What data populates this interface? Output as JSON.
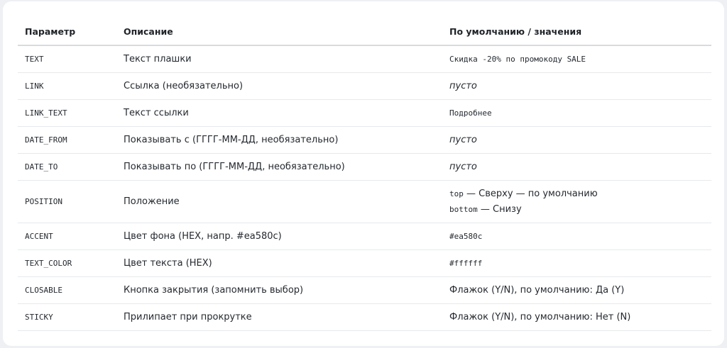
{
  "headers": {
    "param": "Параметр",
    "desc": "Описание",
    "default": "По умолчанию / значения"
  },
  "rows": [
    {
      "param": "TEXT",
      "desc": "Текст плашки",
      "default": "Скидка -20% по промокоду SALE"
    },
    {
      "param": "LINK",
      "desc": "Ссылка (необязательно)",
      "default": "пусто"
    },
    {
      "param": "LINK_TEXT",
      "desc": "Текст ссылки",
      "default": "Подробнее"
    },
    {
      "param": "DATE_FROM",
      "desc": "Показывать с (ГГГГ-ММ-ДД, необязательно)",
      "default": "пусто"
    },
    {
      "param": "DATE_TO",
      "desc": "Показывать по (ГГГГ-ММ-ДД, необязательно)",
      "default": "пусто"
    },
    {
      "param": "POSITION",
      "desc": "Положение",
      "default_lines": [
        {
          "code": "top",
          "text": " — Сверху — по умолчанию"
        },
        {
          "code": "bottom",
          "text": " — Снизу"
        }
      ]
    },
    {
      "param": "ACCENT",
      "desc": "Цвет фона (HEX, напр. #ea580c)",
      "default": "#ea580c"
    },
    {
      "param": "TEXT_COLOR",
      "desc": "Цвет текста (HEX)",
      "default": "#ffffff"
    },
    {
      "param": "CLOSABLE",
      "desc": "Кнопка закрытия (запомнить выбор)",
      "default": "Флажок (Y/N), по умолчанию: Да (Y)"
    },
    {
      "param": "STICKY",
      "desc": "Прилипает при прокрутке",
      "default": "Флажок (Y/N), по умолчанию: Нет (N)"
    }
  ]
}
